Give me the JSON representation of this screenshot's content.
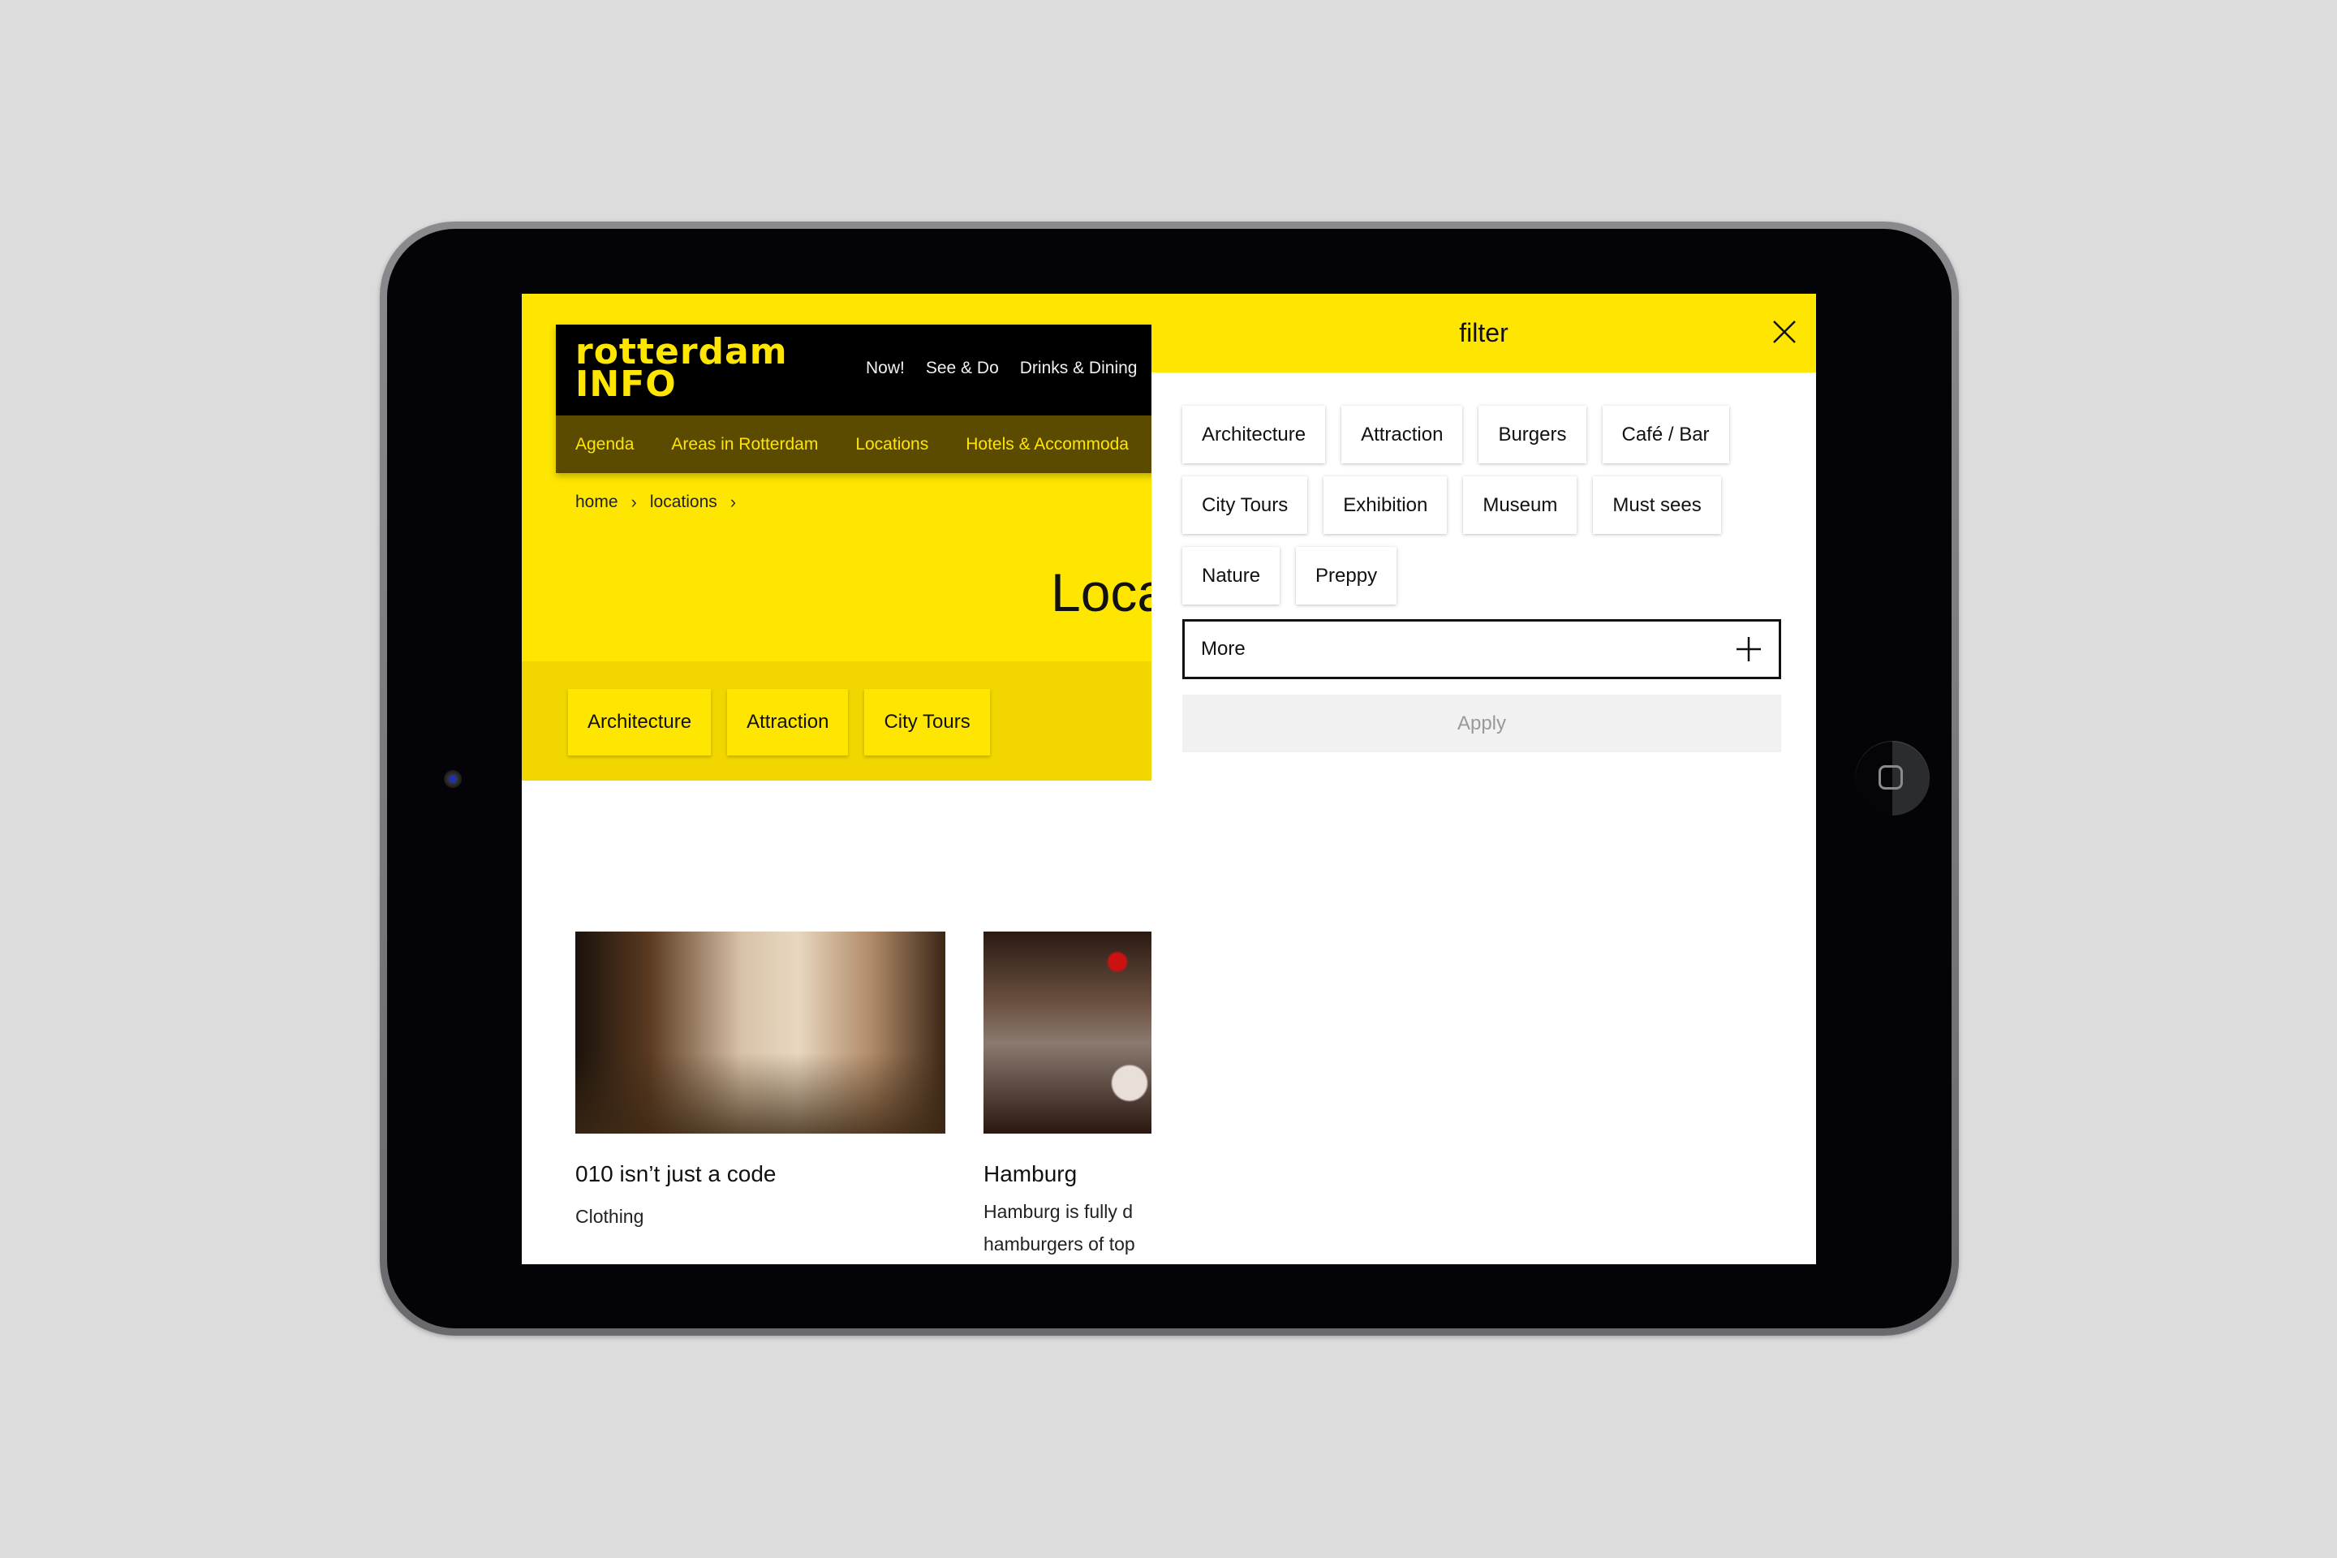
{
  "site": {
    "logo": {
      "line1": "rotterdam",
      "line2": "INFO"
    },
    "top_nav": [
      "Now!",
      "See & Do",
      "Drinks & Dining"
    ],
    "sub_nav": [
      "Agenda",
      "Areas in Rotterdam",
      "Locations",
      "Hotels & Accommoda"
    ],
    "breadcrumb": [
      "home",
      "locations"
    ],
    "breadcrumb_separator": "›",
    "page_title": "Loca",
    "category_chips": [
      "Architecture",
      "Attraction",
      "City Tours"
    ],
    "cards": [
      {
        "title": "010 isn’t just a code",
        "subtitle": "Clothing",
        "image": "clothing-store-photo"
      },
      {
        "title": "Hamburg",
        "description_lines": [
          "Hamburg is fully d",
          "hamburgers of top"
        ],
        "image": "burger-restaurant-photo"
      }
    ]
  },
  "filter": {
    "title": "filter",
    "close_icon": "close-icon",
    "chips": [
      "Architecture",
      "Attraction",
      "Burgers",
      "Café / Bar",
      "City Tours",
      "Exhibition",
      "Museum",
      "Must sees",
      "Nature",
      "Preppy"
    ],
    "more_label": "More",
    "more_icon": "plus-icon",
    "apply_label": "Apply"
  },
  "colors": {
    "brand_yellow": "#ffe600",
    "strip_yellow": "#f2d600",
    "nav_olive": "#5a4b00",
    "header_black": "#000000",
    "apply_disabled_bg": "#f1f1f1"
  }
}
